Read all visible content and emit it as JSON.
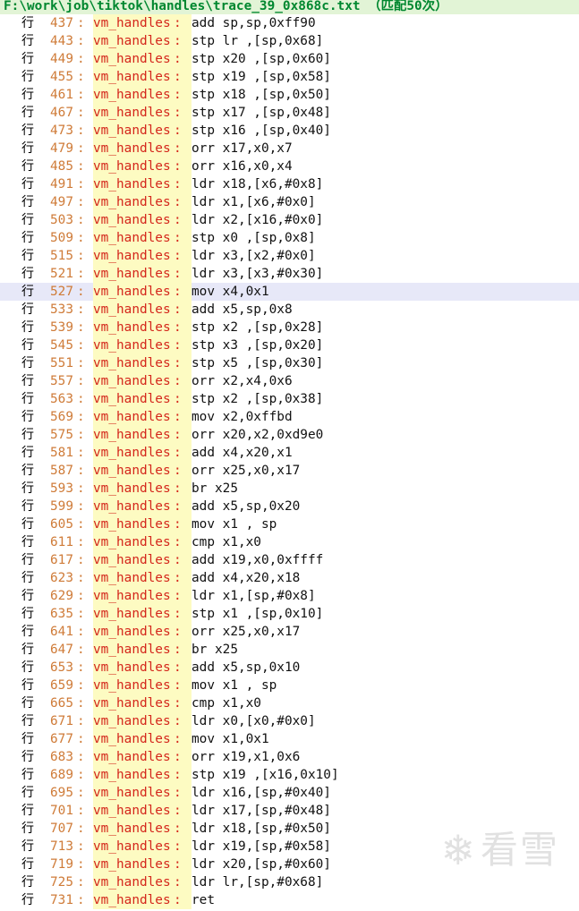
{
  "header": {
    "title": "F:\\work\\job\\tiktok\\handles\\trace_39_0x868c.txt （匹配50次）"
  },
  "row_prefix": "行",
  "results": [
    {
      "line": "437",
      "func": "vm_handles",
      "ins": "add sp,sp,0xff90"
    },
    {
      "line": "443",
      "func": "vm_handles",
      "ins": "stp lr ,[sp,0x68]"
    },
    {
      "line": "449",
      "func": "vm_handles",
      "ins": "stp x20 ,[sp,0x60]"
    },
    {
      "line": "455",
      "func": "vm_handles",
      "ins": "stp x19 ,[sp,0x58]"
    },
    {
      "line": "461",
      "func": "vm_handles",
      "ins": "stp x18 ,[sp,0x50]"
    },
    {
      "line": "467",
      "func": "vm_handles",
      "ins": "stp x17 ,[sp,0x48]"
    },
    {
      "line": "473",
      "func": "vm_handles",
      "ins": "stp x16 ,[sp,0x40]"
    },
    {
      "line": "479",
      "func": "vm_handles",
      "ins": "orr x17,x0,x7"
    },
    {
      "line": "485",
      "func": "vm_handles",
      "ins": "orr x16,x0,x4"
    },
    {
      "line": "491",
      "func": "vm_handles",
      "ins": "ldr x18,[x6,#0x8]"
    },
    {
      "line": "497",
      "func": "vm_handles",
      "ins": "ldr x1,[x6,#0x0]"
    },
    {
      "line": "503",
      "func": "vm_handles",
      "ins": "ldr x2,[x16,#0x0]"
    },
    {
      "line": "509",
      "func": "vm_handles",
      "ins": "stp x0 ,[sp,0x8]"
    },
    {
      "line": "515",
      "func": "vm_handles",
      "ins": "ldr x3,[x2,#0x0]"
    },
    {
      "line": "521",
      "func": "vm_handles",
      "ins": "ldr x3,[x3,#0x30]"
    },
    {
      "line": "527",
      "func": "vm_handles",
      "ins": "mov x4,0x1",
      "selected": true
    },
    {
      "line": "533",
      "func": "vm_handles",
      "ins": "add x5,sp,0x8"
    },
    {
      "line": "539",
      "func": "vm_handles",
      "ins": "stp x2 ,[sp,0x28]"
    },
    {
      "line": "545",
      "func": "vm_handles",
      "ins": "stp x3 ,[sp,0x20]"
    },
    {
      "line": "551",
      "func": "vm_handles",
      "ins": "stp x5 ,[sp,0x30]"
    },
    {
      "line": "557",
      "func": "vm_handles",
      "ins": "orr x2,x4,0x6"
    },
    {
      "line": "563",
      "func": "vm_handles",
      "ins": "stp x2 ,[sp,0x38]"
    },
    {
      "line": "569",
      "func": "vm_handles",
      "ins": "mov x2,0xffbd"
    },
    {
      "line": "575",
      "func": "vm_handles",
      "ins": "orr x20,x2,0xd9e0"
    },
    {
      "line": "581",
      "func": "vm_handles",
      "ins": "add x4,x20,x1"
    },
    {
      "line": "587",
      "func": "vm_handles",
      "ins": "orr x25,x0,x17"
    },
    {
      "line": "593",
      "func": "vm_handles",
      "ins": "br x25"
    },
    {
      "line": "599",
      "func": "vm_handles",
      "ins": "add x5,sp,0x20"
    },
    {
      "line": "605",
      "func": "vm_handles",
      "ins": "mov x1 , sp"
    },
    {
      "line": "611",
      "func": "vm_handles",
      "ins": "cmp x1,x0"
    },
    {
      "line": "617",
      "func": "vm_handles",
      "ins": "add x19,x0,0xffff"
    },
    {
      "line": "623",
      "func": "vm_handles",
      "ins": "add x4,x20,x18"
    },
    {
      "line": "629",
      "func": "vm_handles",
      "ins": "ldr x1,[sp,#0x8]"
    },
    {
      "line": "635",
      "func": "vm_handles",
      "ins": "stp x1 ,[sp,0x10]"
    },
    {
      "line": "641",
      "func": "vm_handles",
      "ins": "orr x25,x0,x17"
    },
    {
      "line": "647",
      "func": "vm_handles",
      "ins": "br x25"
    },
    {
      "line": "653",
      "func": "vm_handles",
      "ins": "add x5,sp,0x10"
    },
    {
      "line": "659",
      "func": "vm_handles",
      "ins": "mov x1 , sp"
    },
    {
      "line": "665",
      "func": "vm_handles",
      "ins": "cmp x1,x0"
    },
    {
      "line": "671",
      "func": "vm_handles",
      "ins": "ldr x0,[x0,#0x0]"
    },
    {
      "line": "677",
      "func": "vm_handles",
      "ins": "mov x1,0x1"
    },
    {
      "line": "683",
      "func": "vm_handles",
      "ins": "orr x19,x1,0x6"
    },
    {
      "line": "689",
      "func": "vm_handles",
      "ins": "stp x19 ,[x16,0x10]"
    },
    {
      "line": "695",
      "func": "vm_handles",
      "ins": "ldr x16,[sp,#0x40]"
    },
    {
      "line": "701",
      "func": "vm_handles",
      "ins": "ldr x17,[sp,#0x48]"
    },
    {
      "line": "707",
      "func": "vm_handles",
      "ins": "ldr x18,[sp,#0x50]"
    },
    {
      "line": "713",
      "func": "vm_handles",
      "ins": "ldr x19,[sp,#0x58]"
    },
    {
      "line": "719",
      "func": "vm_handles",
      "ins": "ldr x20,[sp,#0x60]"
    },
    {
      "line": "725",
      "func": "vm_handles",
      "ins": "ldr lr,[sp,#0x68]"
    },
    {
      "line": "731",
      "func": "vm_handles",
      "ins": "ret"
    }
  ],
  "watermark": {
    "text": "看雪",
    "icon": "snowflake-icon"
  }
}
